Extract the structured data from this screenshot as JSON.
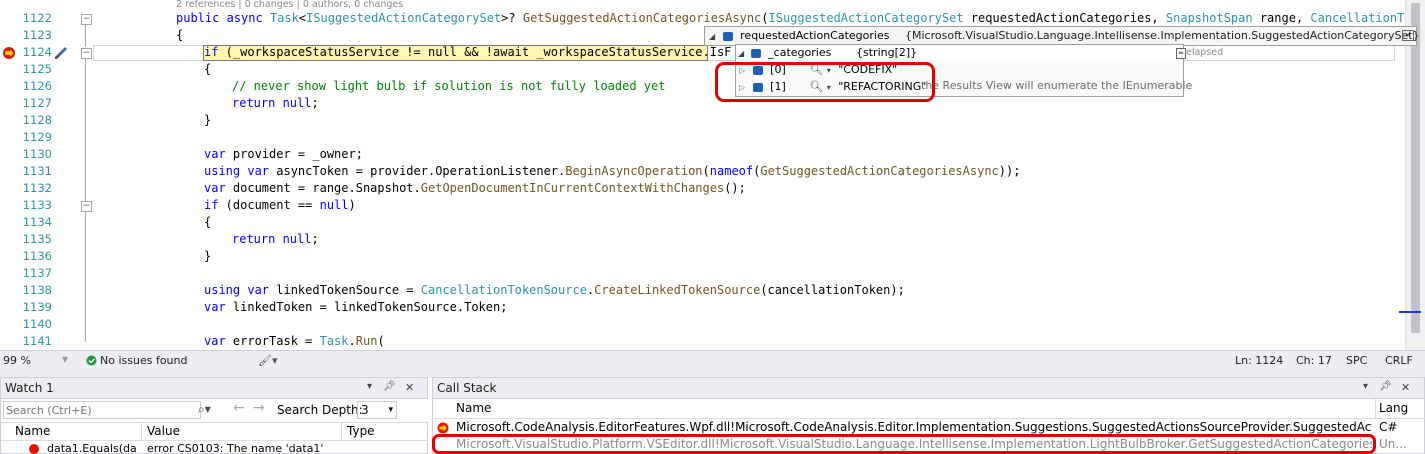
{
  "editor": {
    "codelens": "2 references | 0 changes | 0 authors, 0 changes",
    "signature": {
      "kw_public": "public",
      "kw_async": "async",
      "task": "Task",
      "generic_open": "<",
      "return_type": "ISuggestedActionCategorySet",
      "generic_close": ">?",
      "method": "GetSuggestedActionCategoriesAsync",
      "paren_open": "(",
      "p1_type": "ISuggestedActionCategorySet",
      "p1_name": " requestedActionCategories, ",
      "p2_type": "SnapshotSpan",
      "p2_name": " range, ",
      "p3_type": "CancellationToke"
    },
    "line_numbers": [
      "1122",
      "1123",
      "1124",
      "1125",
      "1126",
      "1127",
      "1128",
      "1129",
      "1130",
      "1131",
      "1132",
      "1133",
      "1134",
      "1135",
      "1136",
      "1137",
      "1138",
      "1139",
      "1140",
      "1141"
    ],
    "lines": {
      "l1123": "{",
      "l1124_kw": "if",
      "l1124_rest": " (_workspaceStatusService != null && !await _workspaceStatusService.IsF",
      "l1125": "{",
      "l1126_comment": "// never show light bulb if solution is not fully loaded yet",
      "l1127_kw": "return",
      "l1127_null": " null",
      "l1127_semi": ";",
      "l1128": "}",
      "l1130_kw": "var",
      "l1130_rest": " provider = _owner;",
      "l1131_using": "using",
      "l1131_var": " var",
      "l1131_rest1": " asyncToken = provider.OperationListener.",
      "l1131_m1": "BeginAsyncOperation",
      "l1131_paren": "(",
      "l1131_nameof": "nameof",
      "l1131_paren2": "(",
      "l1131_m2": "GetSuggestedActionCategoriesAsync",
      "l1131_end": "));",
      "l1132_kw": "var",
      "l1132_rest": " document = range.Snapshot.",
      "l1132_m": "GetOpenDocumentInCurrentContextWithChanges",
      "l1132_end": "();",
      "l1133_kw": "if",
      "l1133_rest": " (document == ",
      "l1133_null": "null",
      "l1133_end": ")",
      "l1134": "{",
      "l1135_kw": "return",
      "l1135_null": " null",
      "l1135_semi": ";",
      "l1136": "}",
      "l1138_using": "using",
      "l1138_var": " var",
      "l1138_rest": " linkedTokenSource = ",
      "l1138_type": "CancellationTokenSource",
      "l1138_dot": ".",
      "l1138_m": "CreateLinkedTokenSource",
      "l1138_end": "(cancellationToken);",
      "l1139_kw": "var",
      "l1139_rest": " linkedToken = linkedTokenSource.Token;",
      "l1141_kw": "var",
      "l1141_rest": " errorTask = ",
      "l1141_type": "Task",
      "l1141_dot": ".",
      "l1141_m": "Run",
      "l1141_end": "("
    }
  },
  "datatip": {
    "root_name": "requestedActionCategories",
    "root_value": "{Microsoft.VisualStudio.Language.Intellisense.Implementation.SuggestedActionCategorySet}",
    "child_name": "_categories",
    "child_value": "{string[2]}",
    "elapsed": "elapsed",
    "results_view_hint": "the Results View will enumerate the IEnumerable",
    "items": [
      {
        "index": "[0]",
        "value": "\"CODEFIX\""
      },
      {
        "index": "[1]",
        "value": "\"REFACTORING\""
      }
    ]
  },
  "statusbar": {
    "zoom": "99 %",
    "issues": "No issues found",
    "ln": "Ln: 1124",
    "ch": "Ch: 17",
    "spc": "SPC",
    "crlf": "CRLF"
  },
  "watch": {
    "title": "Watch 1",
    "search_placeholder": "Search (Ctrl+E)",
    "search_depth_label": "Search Depth:",
    "search_depth_value": "3",
    "columns": [
      "Name",
      "Value",
      "Type"
    ],
    "row_name": "data1.Equals(da",
    "row_value": "error CS0103: The name 'data1'"
  },
  "callstack": {
    "title": "Call Stack",
    "columns": [
      "Name",
      "Lang"
    ],
    "rows": [
      {
        "name": "Microsoft.CodeAnalysis.EditorFeatures.Wpf.dll!Microsoft.CodeAnalysis.Editor.Implementation.Suggestions.SuggestedActionsSourceProvider.SuggestedActionsSource.GetSu...",
        "lang": "C#"
      },
      {
        "name": "Microsoft.VisualStudio.Platform.VSEditor.dll!Microsoft.VisualStudio.Language.Intellisense.Implementation.LightBulbBroker.GetSuggestedActionCategoriesAsync.Anonymou...",
        "lang": "Un..."
      }
    ]
  },
  "colors": {
    "highlight": "#e00000",
    "accent": "#1e3bd1"
  }
}
